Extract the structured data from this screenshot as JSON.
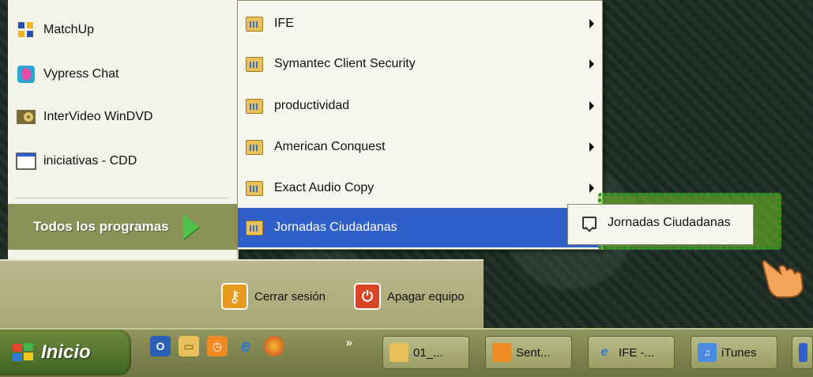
{
  "pinned_programs": [
    {
      "label": "MatchUp",
      "icon": "matchup-icon"
    },
    {
      "label": "Vypress Chat",
      "icon": "vypress-chat-icon"
    },
    {
      "label": "InterVideo WinDVD",
      "icon": "windvd-icon"
    },
    {
      "label": "iniciativas - CDD",
      "icon": "window-icon"
    }
  ],
  "all_programs_label": "Todos los programas",
  "programs_menu": [
    {
      "label": "IFE"
    },
    {
      "label": "Symantec Client Security"
    },
    {
      "label": "productividad"
    },
    {
      "label": "American Conquest"
    },
    {
      "label": "Exact Audio Copy"
    },
    {
      "label": "Jornadas Ciudadanas"
    }
  ],
  "submenu_item": "Jornadas Ciudadanas",
  "logout_label": "Cerrar sesión",
  "shutdown_label": "Apagar equipo",
  "start_label": "Inicio",
  "taskbar_chevron": "»",
  "taskbar_buttons": [
    {
      "label": "01_..."
    },
    {
      "label": "Sent..."
    },
    {
      "label": "IFE -..."
    },
    {
      "label": "iTunes"
    }
  ],
  "colors": {
    "menu_highlight": "#2f5fc9",
    "all_programs_bg": "#8a9257",
    "highlight_box": "#1a8a2a"
  }
}
